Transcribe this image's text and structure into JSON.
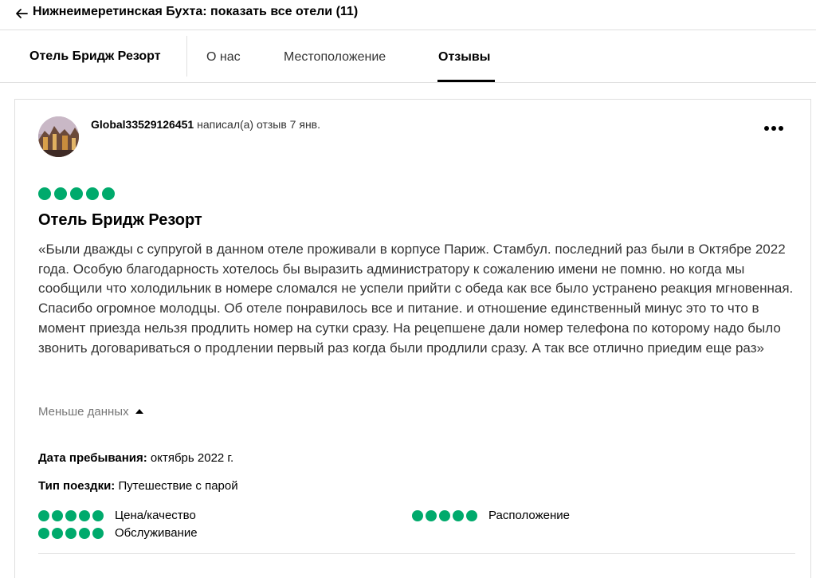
{
  "header": {
    "back_label": "Нижнеимеретинская Бухта: показать все отели (11)"
  },
  "tabs": {
    "hotel_name": "Отель Бридж Резорт",
    "items": [
      "О нас",
      "Местоположение",
      "Отзывы"
    ],
    "active": "Отзывы"
  },
  "review": {
    "author": "Global33529126451",
    "action": " написал(а) отзыв 7 янв.",
    "rating": 5,
    "title": "Отель Бридж Резорт",
    "text": "«Были дважды с супругой в данном отеле проживали в корпусе Париж. Стамбул. последний раз были в Октябре 2022 года. Особую благодарность хотелось бы выразить администратору к сожалению имени не помню. но когда мы сообщили что холодильник в номере сломался не успели прийти с обеда как все было устранено реакция мгновенная. Спасибо огромное молодцы. Об отеле понравилось все и питание. и отношение единственный минус это то что в момент приезда нельзя продлить номер на сутки сразу. На рецепшене дали номер телефона по которому надо было звонить договариваться о продлении первый раз когда были продлили сразу. А так все отлично приедим еще раз»",
    "less_label": "Меньше данных",
    "stay_label": "Дата пребывания:",
    "stay_value": " октябрь 2022 г.",
    "trip_label": "Тип поездки:",
    "trip_value": " Путешествие с парой",
    "subratings": [
      {
        "label": "Цена/качество",
        "rating": 5
      },
      {
        "label": "Расположение",
        "rating": 5
      },
      {
        "label": "Обслуживание",
        "rating": 5
      }
    ]
  },
  "colors": {
    "bubble": "#00aa6c"
  },
  "icons": {
    "back": "arrow-left-icon",
    "menu": "more-horizontal-icon"
  }
}
